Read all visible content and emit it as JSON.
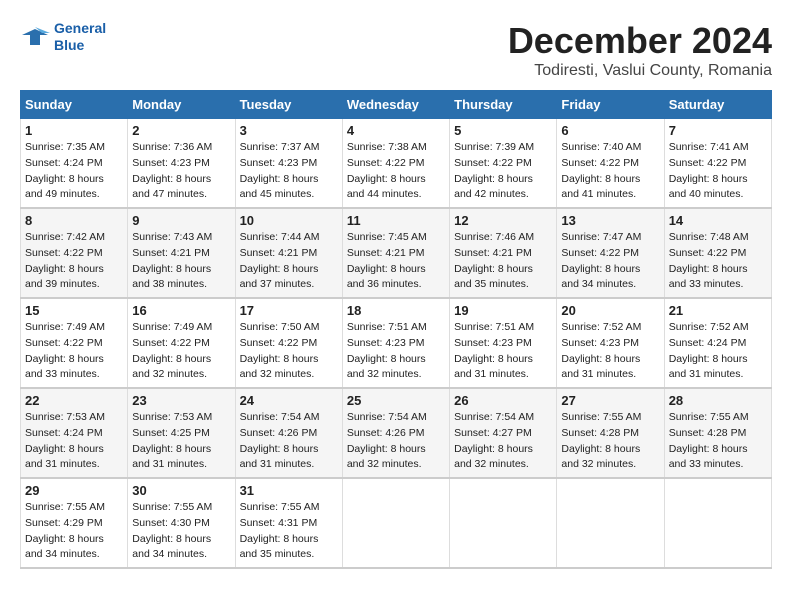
{
  "header": {
    "logo_line1": "General",
    "logo_line2": "Blue",
    "title": "December 2024",
    "subtitle": "Todiresti, Vaslui County, Romania"
  },
  "calendar": {
    "headers": [
      "Sunday",
      "Monday",
      "Tuesday",
      "Wednesday",
      "Thursday",
      "Friday",
      "Saturday"
    ],
    "weeks": [
      [
        {
          "day": "1",
          "sunrise": "7:35 AM",
          "sunset": "4:24 PM",
          "daylight": "8 hours and 49 minutes."
        },
        {
          "day": "2",
          "sunrise": "7:36 AM",
          "sunset": "4:23 PM",
          "daylight": "8 hours and 47 minutes."
        },
        {
          "day": "3",
          "sunrise": "7:37 AM",
          "sunset": "4:23 PM",
          "daylight": "8 hours and 45 minutes."
        },
        {
          "day": "4",
          "sunrise": "7:38 AM",
          "sunset": "4:22 PM",
          "daylight": "8 hours and 44 minutes."
        },
        {
          "day": "5",
          "sunrise": "7:39 AM",
          "sunset": "4:22 PM",
          "daylight": "8 hours and 42 minutes."
        },
        {
          "day": "6",
          "sunrise": "7:40 AM",
          "sunset": "4:22 PM",
          "daylight": "8 hours and 41 minutes."
        },
        {
          "day": "7",
          "sunrise": "7:41 AM",
          "sunset": "4:22 PM",
          "daylight": "8 hours and 40 minutes."
        }
      ],
      [
        {
          "day": "8",
          "sunrise": "7:42 AM",
          "sunset": "4:22 PM",
          "daylight": "8 hours and 39 minutes."
        },
        {
          "day": "9",
          "sunrise": "7:43 AM",
          "sunset": "4:21 PM",
          "daylight": "8 hours and 38 minutes."
        },
        {
          "day": "10",
          "sunrise": "7:44 AM",
          "sunset": "4:21 PM",
          "daylight": "8 hours and 37 minutes."
        },
        {
          "day": "11",
          "sunrise": "7:45 AM",
          "sunset": "4:21 PM",
          "daylight": "8 hours and 36 minutes."
        },
        {
          "day": "12",
          "sunrise": "7:46 AM",
          "sunset": "4:21 PM",
          "daylight": "8 hours and 35 minutes."
        },
        {
          "day": "13",
          "sunrise": "7:47 AM",
          "sunset": "4:22 PM",
          "daylight": "8 hours and 34 minutes."
        },
        {
          "day": "14",
          "sunrise": "7:48 AM",
          "sunset": "4:22 PM",
          "daylight": "8 hours and 33 minutes."
        }
      ],
      [
        {
          "day": "15",
          "sunrise": "7:49 AM",
          "sunset": "4:22 PM",
          "daylight": "8 hours and 33 minutes."
        },
        {
          "day": "16",
          "sunrise": "7:49 AM",
          "sunset": "4:22 PM",
          "daylight": "8 hours and 32 minutes."
        },
        {
          "day": "17",
          "sunrise": "7:50 AM",
          "sunset": "4:22 PM",
          "daylight": "8 hours and 32 minutes."
        },
        {
          "day": "18",
          "sunrise": "7:51 AM",
          "sunset": "4:23 PM",
          "daylight": "8 hours and 32 minutes."
        },
        {
          "day": "19",
          "sunrise": "7:51 AM",
          "sunset": "4:23 PM",
          "daylight": "8 hours and 31 minutes."
        },
        {
          "day": "20",
          "sunrise": "7:52 AM",
          "sunset": "4:23 PM",
          "daylight": "8 hours and 31 minutes."
        },
        {
          "day": "21",
          "sunrise": "7:52 AM",
          "sunset": "4:24 PM",
          "daylight": "8 hours and 31 minutes."
        }
      ],
      [
        {
          "day": "22",
          "sunrise": "7:53 AM",
          "sunset": "4:24 PM",
          "daylight": "8 hours and 31 minutes."
        },
        {
          "day": "23",
          "sunrise": "7:53 AM",
          "sunset": "4:25 PM",
          "daylight": "8 hours and 31 minutes."
        },
        {
          "day": "24",
          "sunrise": "7:54 AM",
          "sunset": "4:26 PM",
          "daylight": "8 hours and 31 minutes."
        },
        {
          "day": "25",
          "sunrise": "7:54 AM",
          "sunset": "4:26 PM",
          "daylight": "8 hours and 32 minutes."
        },
        {
          "day": "26",
          "sunrise": "7:54 AM",
          "sunset": "4:27 PM",
          "daylight": "8 hours and 32 minutes."
        },
        {
          "day": "27",
          "sunrise": "7:55 AM",
          "sunset": "4:28 PM",
          "daylight": "8 hours and 32 minutes."
        },
        {
          "day": "28",
          "sunrise": "7:55 AM",
          "sunset": "4:28 PM",
          "daylight": "8 hours and 33 minutes."
        }
      ],
      [
        {
          "day": "29",
          "sunrise": "7:55 AM",
          "sunset": "4:29 PM",
          "daylight": "8 hours and 34 minutes."
        },
        {
          "day": "30",
          "sunrise": "7:55 AM",
          "sunset": "4:30 PM",
          "daylight": "8 hours and 34 minutes."
        },
        {
          "day": "31",
          "sunrise": "7:55 AM",
          "sunset": "4:31 PM",
          "daylight": "8 hours and 35 minutes."
        },
        null,
        null,
        null,
        null
      ]
    ]
  }
}
